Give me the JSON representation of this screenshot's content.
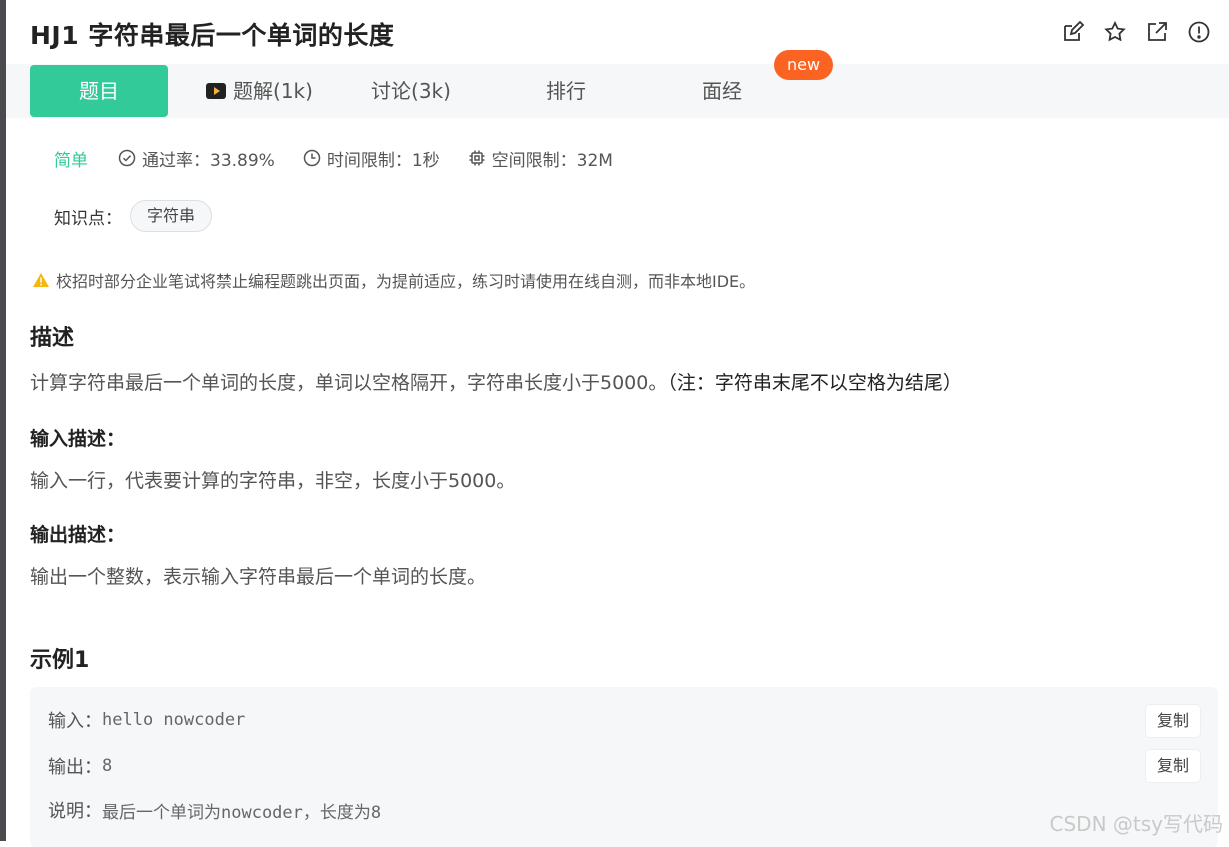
{
  "title": "HJ1  字符串最后一个单词的长度",
  "title_icons": [
    "edit-icon",
    "star-icon",
    "external-link-icon",
    "info-icon"
  ],
  "tabs": [
    {
      "label": "题目",
      "active": true
    },
    {
      "label": "题解(1k)",
      "icon": "video-icon"
    },
    {
      "label": "讨论(3k)"
    },
    {
      "label": "排行"
    },
    {
      "label": "面经"
    }
  ],
  "new_badge": "new",
  "meta": {
    "difficulty": "简单",
    "pass_rate": "通过率：33.89%",
    "time_limit": "时间限制：1秒",
    "space_limit": "空间限制：32M"
  },
  "knowledge": {
    "label": "知识点：",
    "tag": "字符串"
  },
  "warning": "校招时部分企业笔试将禁止编程题跳出页面，为提前适应，练习时请使用在线自测，而非本地IDE。",
  "sections": {
    "desc_title": "描述",
    "desc_text": "计算字符串最后一个单词的长度，单词以空格隔开，字符串长度小于5000。",
    "desc_note": "（注：字符串末尾不以空格为结尾）",
    "input_title": "输入描述：",
    "input_text": "输入一行，代表要计算的字符串，非空，长度小于5000。",
    "output_title": "输出描述：",
    "output_text": "输出一个整数，表示输入字符串最后一个单词的长度。"
  },
  "example": {
    "title": "示例1",
    "input_label": "输入：",
    "input_value": "hello nowcoder",
    "output_label": "输出：",
    "output_value": "8",
    "explain_label": "说明：",
    "explain_value": "最后一个单词为nowcoder，长度为8",
    "copy_label": "复制"
  },
  "watermark": "CSDN @tsy写代码",
  "colors": {
    "accent": "#32ca99",
    "badge": "#fb6323",
    "warning": "#f5b70a"
  }
}
